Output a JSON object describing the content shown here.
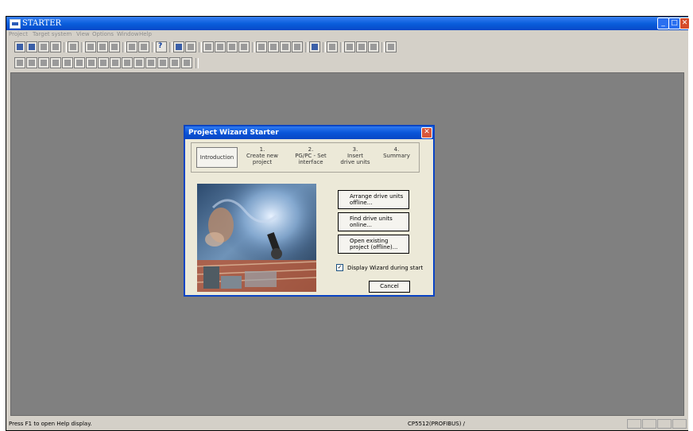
{
  "window": {
    "title": "STARTER",
    "controls": {
      "minimize": "_",
      "maximize": "□",
      "close": "✕"
    }
  },
  "menu": [
    "Project",
    "Target system",
    "View",
    "Options",
    "Window",
    "Help"
  ],
  "toolbar": {
    "help_glyph": "?"
  },
  "dialog": {
    "title": "Project Wizard Starter",
    "close_glyph": "✕",
    "steps": [
      {
        "num": "",
        "label": "Introduction"
      },
      {
        "num": "1.",
        "label": "Create new project"
      },
      {
        "num": "2.",
        "label": "PG/PC - Set interface"
      },
      {
        "num": "3.",
        "label": "Insert drive units"
      },
      {
        "num": "4.",
        "label": "Summary"
      }
    ],
    "buttons": {
      "arrange": "Arrange drive units offline...",
      "find": "Find drive units online...",
      "open": "Open existing project (offline)..."
    },
    "checkbox": {
      "label": "Display Wizard during start",
      "checked": true,
      "mark": "✓"
    },
    "cancel": "Cancel"
  },
  "status": {
    "text": "Press F1 to open Help display.",
    "connection": "CP5512(PROFIBUS) /"
  },
  "colors": {
    "titlebar": "#0a5fdc",
    "workspace": "#808080",
    "dialog_bg": "#ece9d8",
    "close_red": "#d64b2a"
  }
}
